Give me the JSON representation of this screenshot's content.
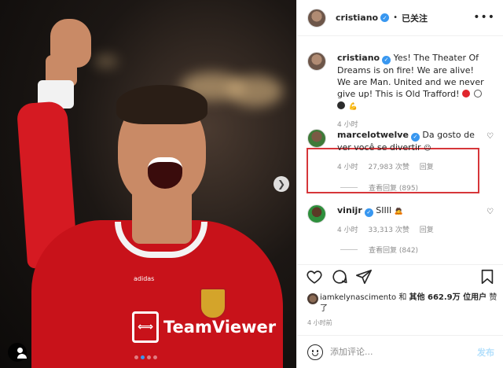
{
  "header": {
    "username": "cristiano",
    "separator": "•",
    "follow_status": "已关注",
    "more_icon": "more-horizontal-icon"
  },
  "caption": {
    "username": "cristiano",
    "text": "Yes! The Theater Of Dreams is on fire! We are alive! We are Man. United and we never give up! This is Old Trafford!",
    "emoji_colors": [
      "#e0262d",
      "#ffffff",
      "#2b2b2b"
    ],
    "trailing_emoji": "💪",
    "time": "4 小时"
  },
  "comments": [
    {
      "username": "marcelotwelve",
      "text": "Da gosto de ver você se divertir",
      "emoji": "☺",
      "time": "4 小时",
      "likes": "27,983 次赞",
      "reply_label": "回复",
      "view_replies": "查看回复 (895)",
      "highlight_color": "#d6363a"
    },
    {
      "username": "vinijr",
      "text": "SIIII",
      "emoji": "🙇",
      "time": "4 小时",
      "likes": "33,313 次赞",
      "reply_label": "回复",
      "view_replies": "查看回复 (842)"
    }
  ],
  "actions": {
    "like_icon": "heart-icon",
    "comment_icon": "comment-icon",
    "share_icon": "send-icon",
    "save_icon": "bookmark-icon"
  },
  "likes": {
    "first_liker": "iamkelynascimento",
    "connector": "和",
    "others_label": "其他 662.9万 位用户",
    "suffix": "赞了"
  },
  "post_time": "4 小时前",
  "add_comment": {
    "placeholder": "添加评论...",
    "post_label": "发布"
  },
  "photo": {
    "sponsor_text": "TeamViewer",
    "brand_text": "adidas",
    "carousel_dots": 4,
    "active_dot": 1,
    "accent_color": "#3897f0"
  }
}
